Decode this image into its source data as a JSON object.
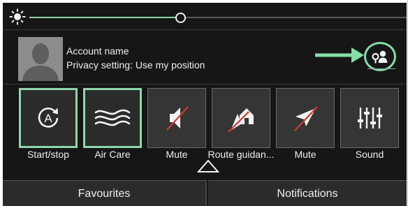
{
  "brightness": {
    "level": 0.4
  },
  "account": {
    "name": "Account name",
    "privacy": "Privacy setting: Use my position"
  },
  "tiles": [
    {
      "id": "start-stop",
      "label": "Start/stop",
      "active": true,
      "icon": "auto-start-stop-icon"
    },
    {
      "id": "air-care",
      "label": "Air Care",
      "active": true,
      "icon": "air-waves-icon"
    },
    {
      "id": "mute-1",
      "label": "Mute",
      "active": false,
      "icon": "speaker-muted-icon"
    },
    {
      "id": "route-guidance",
      "label": "Route guidan...",
      "active": false,
      "icon": "route-home-icon"
    },
    {
      "id": "mute-2",
      "label": "Mute",
      "active": false,
      "icon": "navigation-muted-icon"
    },
    {
      "id": "sound",
      "label": "Sound",
      "active": false,
      "icon": "equalizer-icon"
    }
  ],
  "tabs": {
    "favourites": "Favourites",
    "notifications": "Notifications"
  },
  "colors": {
    "accent": "#8fd6ad",
    "background": "#161616",
    "tile": "#353535",
    "annotation_arrow": "#86dca7"
  }
}
